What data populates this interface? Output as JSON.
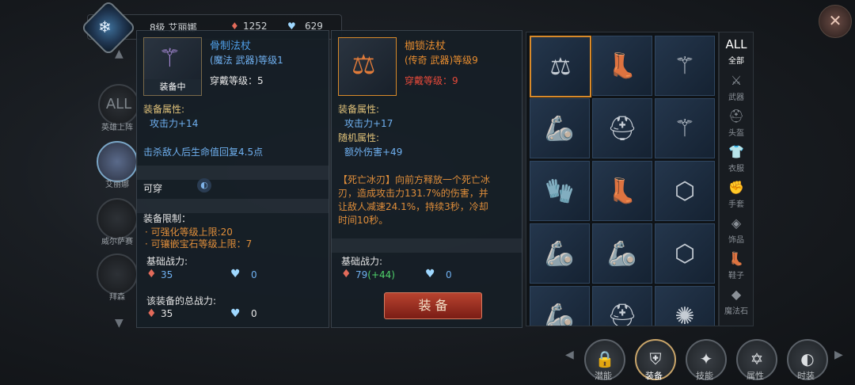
{
  "top": {
    "name": "8级 艾丽娜",
    "power": "1252",
    "defense": "629"
  },
  "hero_column": {
    "all_label": "ALL",
    "entries": [
      {
        "name": "英雄上阵"
      },
      {
        "name": "艾丽娜"
      },
      {
        "name": "威尔萨赛"
      },
      {
        "name": "拜森"
      }
    ]
  },
  "left_panel": {
    "item_name": "骨制法杖",
    "rarity_type": "(魔法 武器)等级1",
    "wear_level": "穿戴等级：5",
    "equipped_label": "装备中",
    "attr_title": "装备属性:",
    "attr": "攻击力+14",
    "effect": "击杀敌人后生命值回复4.5点",
    "wearable": "可穿",
    "limit_title": "装备限制：",
    "limit1": "· 可强化等级上限:20",
    "limit2": "· 可镶嵌宝石等级上限：7",
    "base_power_title": "基础战力:",
    "base_atk": "35",
    "base_def": "0",
    "total_title": "该装备的总战力:",
    "total_atk": "35",
    "total_def": "0"
  },
  "right_panel": {
    "item_name": "枷锁法杖",
    "rarity_type": "(传奇 武器)等级9",
    "wear_level_label": "穿戴等级：",
    "wear_level_value": "9",
    "attr_title": "装备属性:",
    "attr": "攻击力+17",
    "rand_title": "随机属性:",
    "rand_attr": "额外伤害+49",
    "skill_text": "【死亡冰刃】向前方释放一个死亡冰刃，造成攻击力131.7%的伤害，并让敌人减速24.1%，持续3秒，冷却时间10秒。",
    "base_power_title": "基础战力:",
    "base_atk": "79",
    "base_atk_bonus": "(+44)",
    "base_def": "0",
    "equip_button": "装 备"
  },
  "inventory": {
    "cells": [
      {
        "icon": "shackle-staff-icon",
        "glyph": "⚖",
        "sel": true
      },
      {
        "icon": "boots-icon",
        "glyph": "👢"
      },
      {
        "icon": "staff-icon",
        "glyph": "⚚"
      },
      {
        "icon": "gauntlet-icon",
        "glyph": "🦾"
      },
      {
        "icon": "helmet-icon",
        "glyph": "⛑"
      },
      {
        "icon": "staff-icon",
        "glyph": "⚚"
      },
      {
        "icon": "glove-icon",
        "glyph": "🧤"
      },
      {
        "icon": "boots-icon",
        "glyph": "👢"
      },
      {
        "icon": "amulet-icon",
        "glyph": "⬡"
      },
      {
        "icon": "gauntlet-icon",
        "glyph": "🦾"
      },
      {
        "icon": "gauntlet-icon",
        "glyph": "🦾"
      },
      {
        "icon": "amulet-icon",
        "glyph": "⬡"
      },
      {
        "icon": "gauntlet-icon",
        "glyph": "🦾"
      },
      {
        "icon": "helmet-icon",
        "glyph": "⛑"
      },
      {
        "icon": "orb-icon",
        "glyph": "✺"
      }
    ]
  },
  "categories": [
    {
      "label": "全部",
      "glyph": "ALL"
    },
    {
      "label": "武器",
      "glyph": "⚔"
    },
    {
      "label": "头盔",
      "glyph": "⛑"
    },
    {
      "label": "衣服",
      "glyph": "👕"
    },
    {
      "label": "手套",
      "glyph": "✊"
    },
    {
      "label": "饰品",
      "glyph": "◈"
    },
    {
      "label": "鞋子",
      "glyph": "👢"
    },
    {
      "label": "魔法石",
      "glyph": "◆"
    }
  ],
  "bottom_nav": [
    {
      "label": "潜能",
      "glyph": "🔒"
    },
    {
      "label": "装备",
      "glyph": "⛨",
      "active": true
    },
    {
      "label": "技能",
      "glyph": "✦"
    },
    {
      "label": "属性",
      "glyph": "✡"
    },
    {
      "label": "时装",
      "glyph": "◐"
    }
  ],
  "colors": {
    "accent": "#d88a2a",
    "legendary": "#e88d2f",
    "magic": "#4f9fe8"
  }
}
